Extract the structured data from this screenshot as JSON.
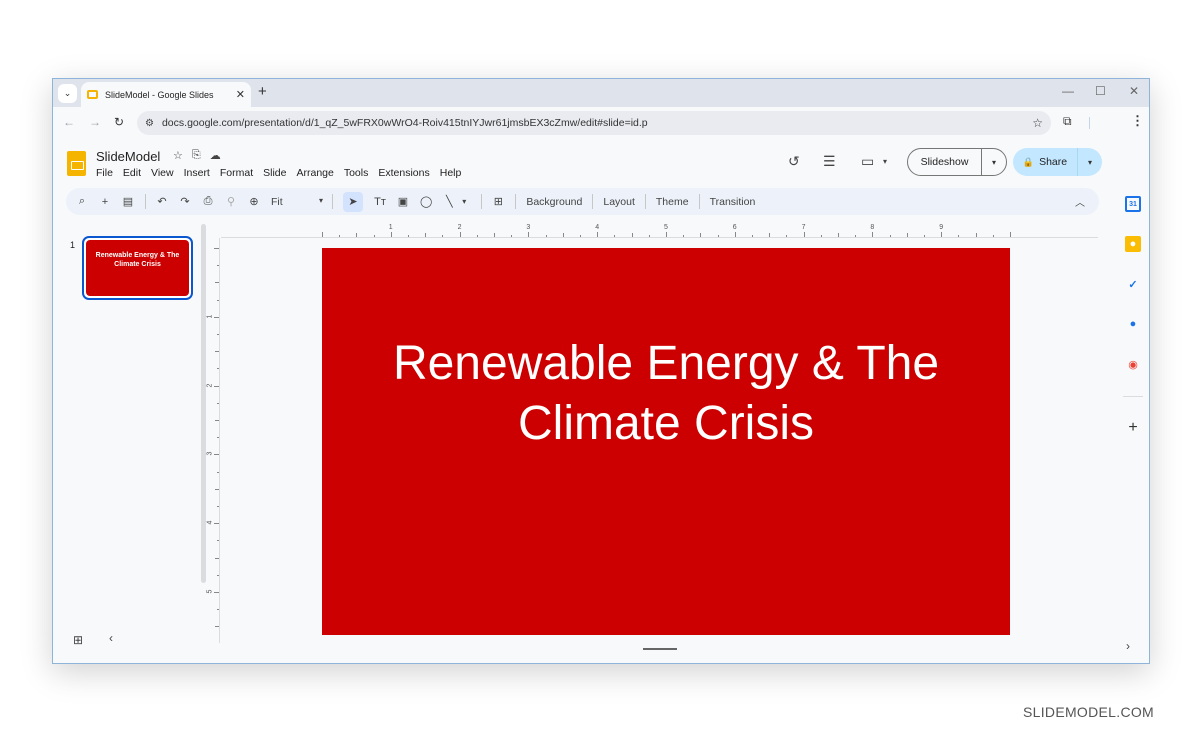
{
  "browser": {
    "tab_title": "SlideModel - Google Slides",
    "tab_close": "✕",
    "new_tab": "+",
    "tab_menu": "⌄",
    "window_controls": {
      "minimize": "—",
      "maximize": "☐",
      "close": "✕"
    },
    "nav": {
      "back": "←",
      "forward": "→",
      "reload": "↻"
    },
    "url": "docs.google.com/presentation/d/1_qZ_5wFRX0wWrO4-Roiv415tnIYJwr61jmsbEX3cZmw/edit#slide=id.p",
    "site_info_icon": "⚙",
    "bookmark_icon": "☆",
    "extensions_icon": "⧉",
    "menu_icon": "⋮"
  },
  "app": {
    "doc_title": "SlideModel",
    "title_icons": {
      "star": "☆",
      "move": "⎘",
      "cloud": "☁"
    },
    "menu": [
      "File",
      "Edit",
      "View",
      "Insert",
      "Format",
      "Slide",
      "Arrange",
      "Tools",
      "Extensions",
      "Help"
    ],
    "header_icons": {
      "history": "↺",
      "comments": "☰",
      "meet": "▭",
      "meet_dd": "▾"
    },
    "slideshow_label": "Slideshow",
    "slideshow_dropdown": "▾",
    "share_label": "Share",
    "share_lock": "🔒",
    "share_dropdown": "▾"
  },
  "toolbar": {
    "search": "⌕",
    "new_slide": "+",
    "layout_pick": "▤",
    "undo": "↶",
    "redo": "↷",
    "print": "⎙",
    "paint_format": "⚲",
    "zoom_icon": "⊕",
    "zoom_value": "Fit",
    "zoom_dd": "▾",
    "select": "➤",
    "textbox": "Tт",
    "image": "▣",
    "shape": "◯",
    "line": "╲",
    "line_dd": "▾",
    "comment": "⊞",
    "background": "Background",
    "layout": "Layout",
    "theme": "Theme",
    "transition": "Transition",
    "collapse": "︿"
  },
  "filmstrip": {
    "slides": [
      {
        "number": "1",
        "title": "Renewable Energy & The Climate Crisis",
        "background": "#cc0000",
        "selected": true
      }
    ],
    "grid_view_icon": "⊞",
    "collapse_icon": "‹"
  },
  "rulers": {
    "horizontal": [
      "1",
      "2",
      "3",
      "4",
      "5",
      "6",
      "7",
      "8",
      "9"
    ],
    "vertical": [
      "1",
      "2",
      "3",
      "4",
      "5"
    ]
  },
  "slide": {
    "title": "Renewable Energy & The Climate Crisis",
    "background": "#cc0000",
    "text_color": "#ffffff"
  },
  "side_panel": {
    "apps": [
      {
        "name": "calendar",
        "glyph": "31",
        "color": "#1a73e8"
      },
      {
        "name": "keep",
        "glyph": "●",
        "color": "#fbbc04"
      },
      {
        "name": "tasks",
        "glyph": "✓",
        "color": "#1a73e8"
      },
      {
        "name": "contacts",
        "glyph": "👤",
        "color": "#1a73e8"
      },
      {
        "name": "maps",
        "glyph": "📍",
        "color": "#ea4335"
      }
    ],
    "add": "+",
    "expand": "›"
  },
  "watermark": "SLIDEMODEL.COM",
  "colors": {
    "accent": "#0b57d0",
    "share_bg": "#c2e7ff",
    "toolbar_bg": "#edf2fa",
    "slide_red": "#cc0000"
  }
}
